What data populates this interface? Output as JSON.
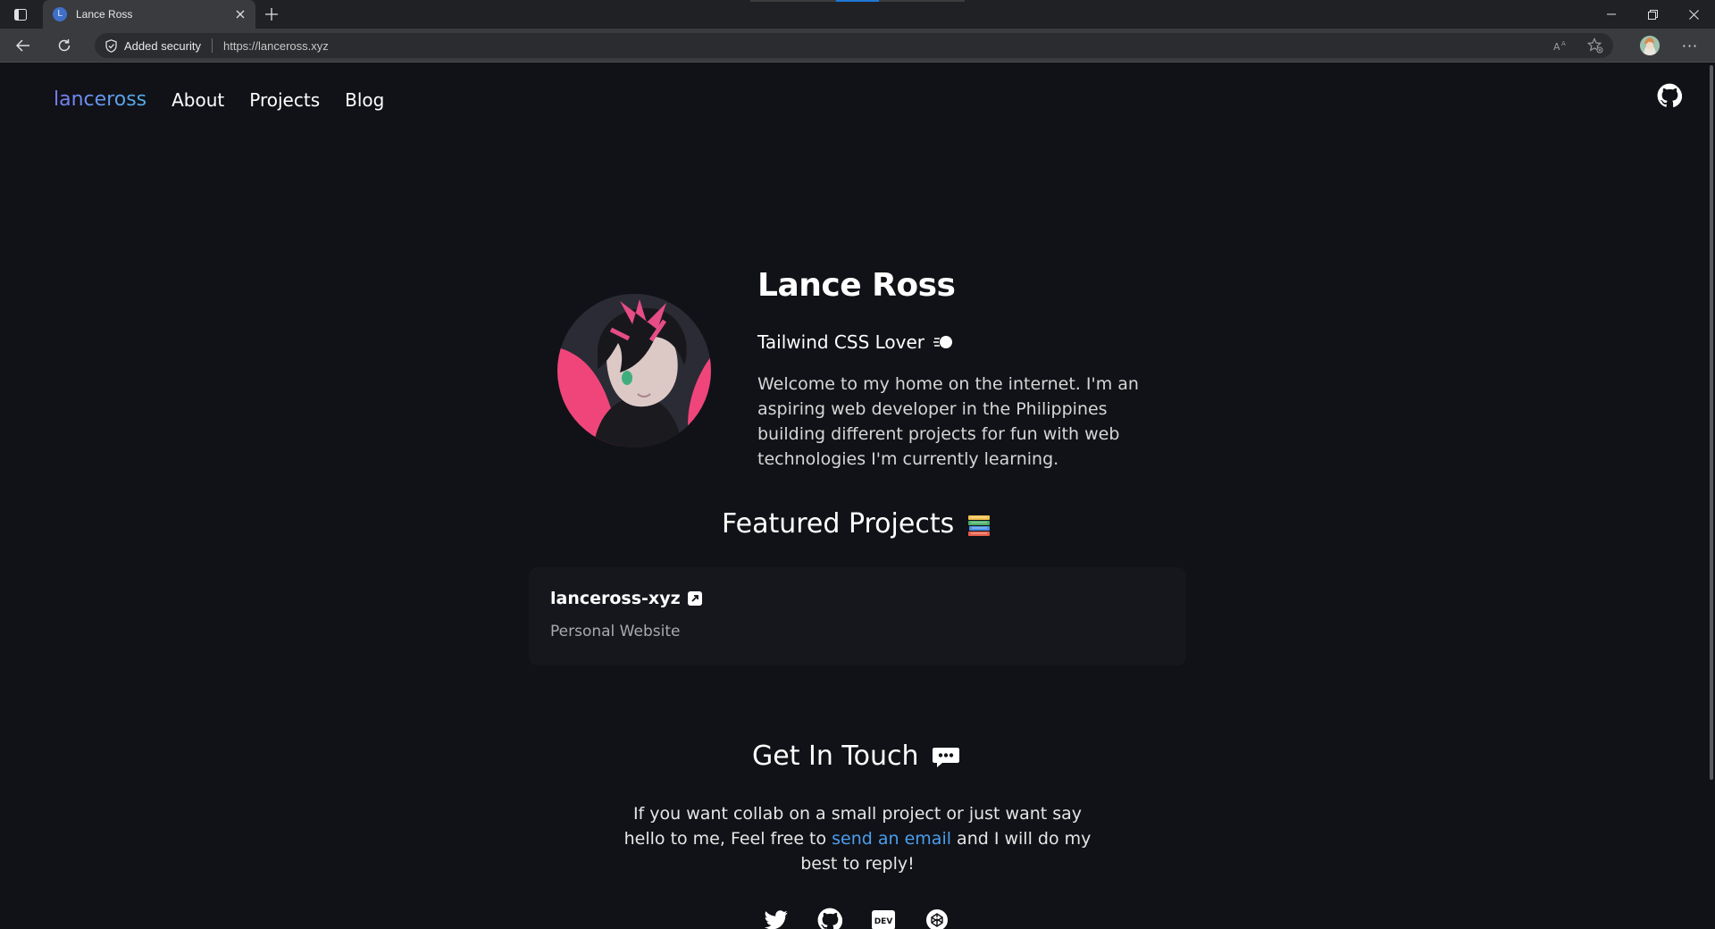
{
  "browser": {
    "tab_title": "Lance Ross",
    "tab_favicon_letter": "L",
    "security_label": "Added security",
    "url": "https://lanceross.xyz",
    "more_label": "···"
  },
  "site": {
    "brand": "lanceross",
    "nav": [
      "About",
      "Projects",
      "Blog"
    ]
  },
  "hero": {
    "name": "Lance Ross",
    "tagline": "Tailwind CSS Lover",
    "bio": "Welcome to my home on the internet. I'm an aspiring web developer in the Philippines building different projects for fun with web technologies I'm currently learning."
  },
  "featured": {
    "title": "Featured Projects",
    "projects": [
      {
        "name": "lanceross-xyz",
        "description": "Personal Website"
      }
    ]
  },
  "contact": {
    "title": "Get In Touch",
    "text_before": "If you want collab on a small project or just want say hello to me, Feel free to ",
    "link_text": "send an email",
    "text_after": " and I will do my best to reply!",
    "link_color": "#4a9ef0"
  },
  "socials": [
    "twitter-icon",
    "github-icon",
    "dev-icon",
    "codepen-icon"
  ],
  "dev_icon_text": "DEV",
  "colors": {
    "page_bg": "#111217",
    "card_bg": "#16171d",
    "brand_gradient_start": "#7b7bf5",
    "brand_gradient_end": "#4fb0e6",
    "avatar_pink": "#f0457a"
  }
}
